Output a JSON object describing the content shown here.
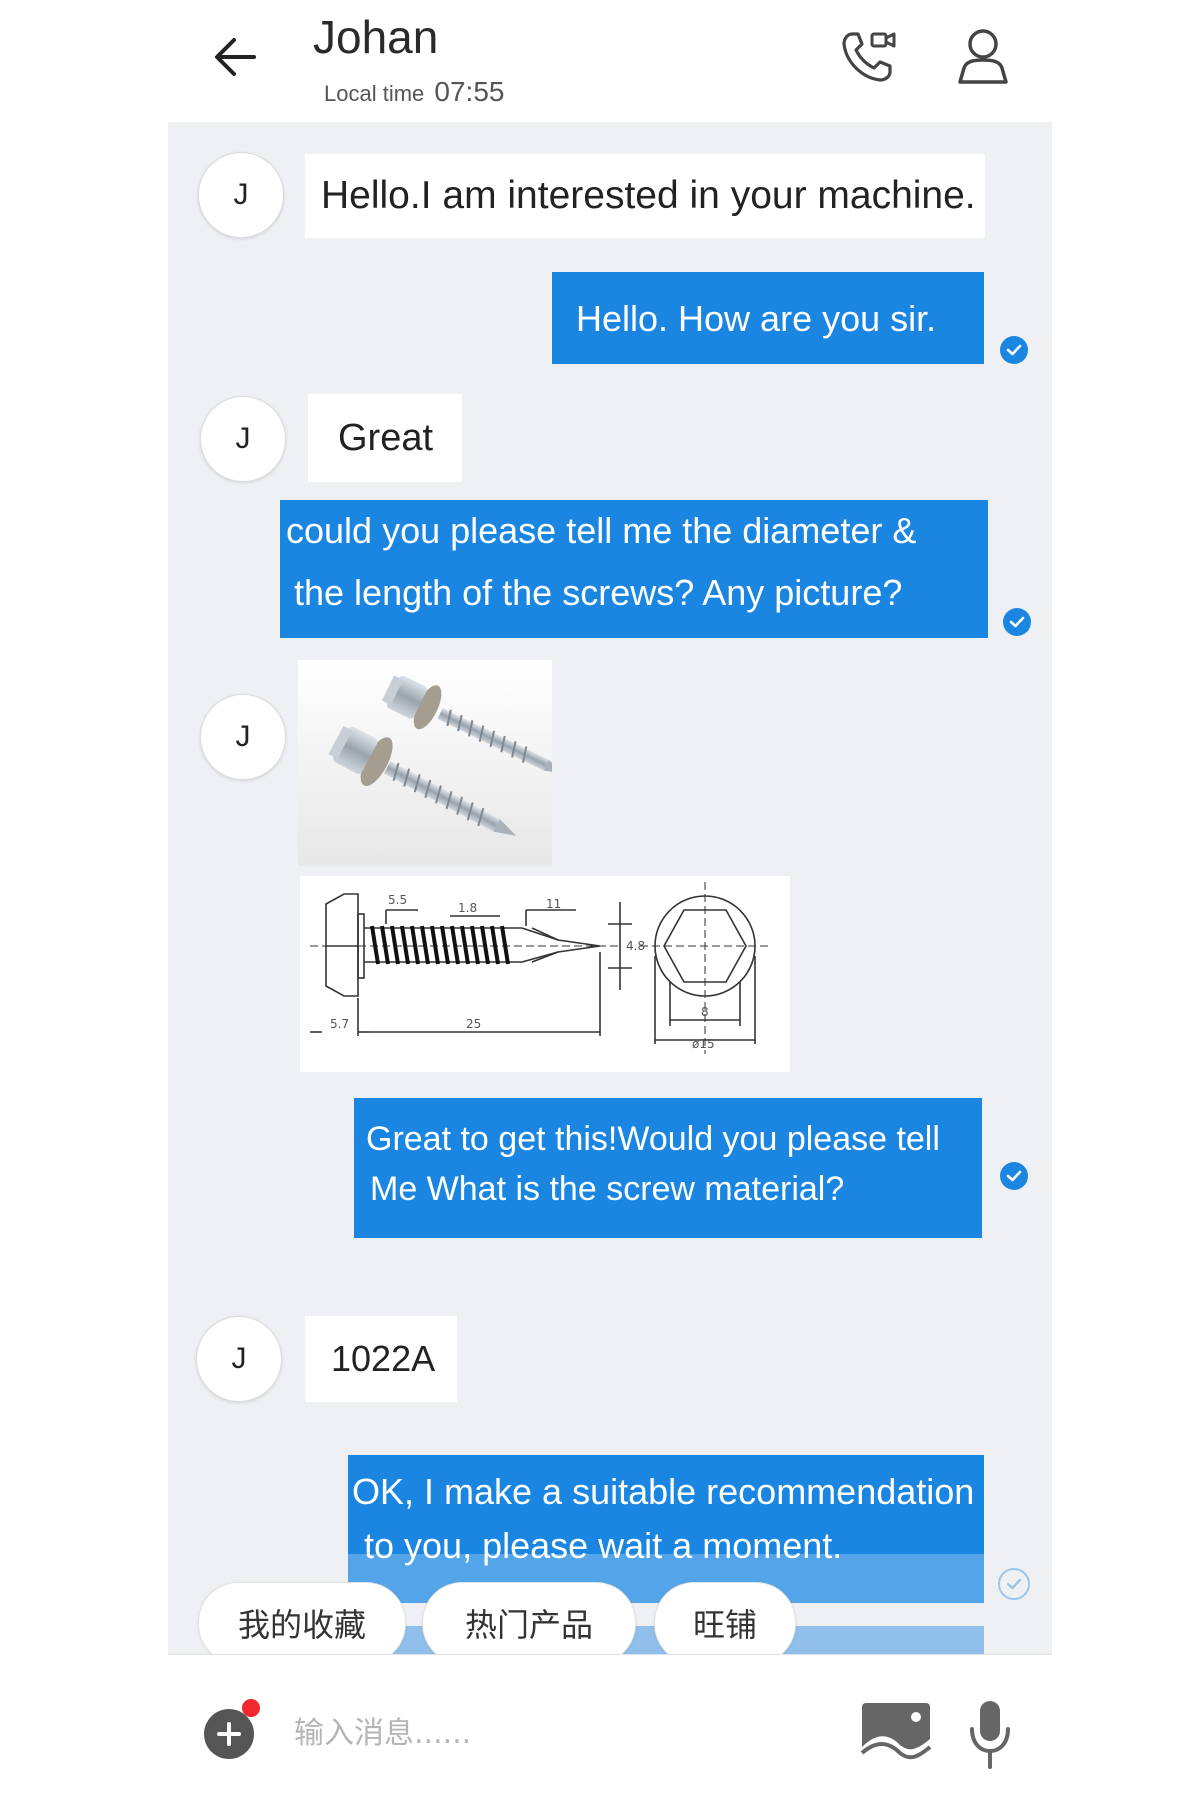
{
  "header": {
    "back_icon": "arrow-left-icon",
    "contact_name": "Johan",
    "local_time_label": "Local time",
    "local_time_value": "07:55",
    "call_icon": "video-phone-icon",
    "profile_icon": "person-icon"
  },
  "messages": [
    {
      "from": "contact",
      "avatar": "J",
      "text": "Hello.I am interested in your machine."
    },
    {
      "from": "me",
      "lines": [
        "Hello. How are you sir."
      ],
      "read": true
    },
    {
      "from": "contact",
      "avatar": "J",
      "text": "Great"
    },
    {
      "from": "me",
      "lines": [
        "could you please tell me the diameter &",
        "the length of the screws? Any picture?"
      ],
      "read": true
    },
    {
      "from": "contact",
      "avatar": "J",
      "type": "image",
      "description": "screws photo"
    },
    {
      "from": "contact",
      "type": "image",
      "description": "screw technical drawing",
      "dims": {
        "head_top": "5.5",
        "pitch": "1.8",
        "tip": "11",
        "dia": "4.8",
        "washer": "5.7",
        "length": "25",
        "hex": "8",
        "washer_dia": "ø15"
      }
    },
    {
      "from": "me",
      "lines": [
        "Great to get this!Would you please tell",
        "Me What is the screw material?"
      ],
      "read": true
    },
    {
      "from": "contact",
      "avatar": "J",
      "text": "1022A"
    },
    {
      "from": "me",
      "lines": [
        "OK, I make a suitable recommendation",
        "to you, please wait a moment."
      ],
      "read": false
    }
  ],
  "quick_replies": [
    "我的收藏",
    "热门产品",
    "旺铺"
  ],
  "input": {
    "placeholder": "输入消息......",
    "add_icon": "plus-circle-icon",
    "image_icon": "image-icon",
    "mic_icon": "microphone-icon"
  },
  "colors": {
    "accent": "#1a86e2",
    "chat_bg": "#eef0f3",
    "badge": "#f0282d"
  }
}
